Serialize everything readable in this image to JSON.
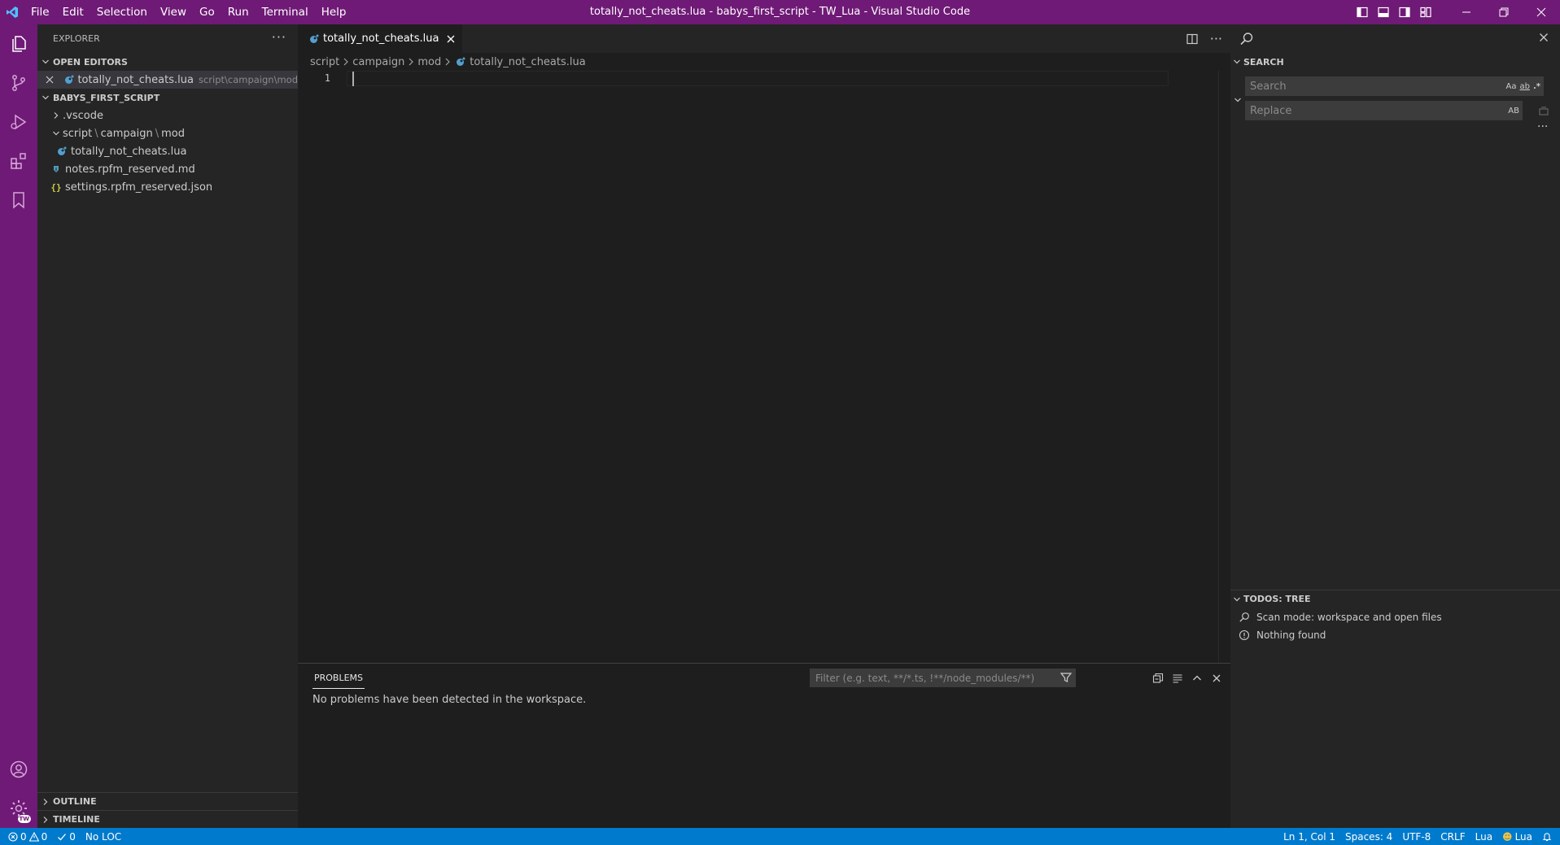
{
  "titlebar": {
    "menu": [
      "File",
      "Edit",
      "Selection",
      "View",
      "Go",
      "Run",
      "Terminal",
      "Help"
    ],
    "title": "totally_not_cheats.lua - babys_first_script - TW_Lua - Visual Studio Code"
  },
  "explorer": {
    "header": "EXPLORER",
    "open_editors_label": "OPEN EDITORS",
    "open_editor": {
      "name": "totally_not_cheats.lua",
      "path": "script\\campaign\\mod"
    },
    "workspace_label": "BABYS_FIRST_SCRIPT",
    "tree": {
      "vscode": ".vscode",
      "folder": {
        "seg1": "script",
        "seg2": "campaign",
        "seg3": "mod"
      },
      "file_lua": "totally_not_cheats.lua",
      "file_md": "notes.rpfm_reserved.md",
      "file_json": "settings.rpfm_reserved.json"
    },
    "outline_label": "OUTLINE",
    "timeline_label": "TIMELINE"
  },
  "editor": {
    "tab_label": "totally_not_cheats.lua",
    "breadcrumb": [
      "script",
      "campaign",
      "mod",
      "totally_not_cheats.lua"
    ],
    "line_number": "1"
  },
  "panel": {
    "tab": "PROBLEMS",
    "filter_placeholder": "Filter (e.g. text, **/*.ts, !**/node_modules/**)",
    "message": "No problems have been detected in the workspace."
  },
  "search": {
    "header": "SEARCH",
    "search_placeholder": "Search",
    "replace_placeholder": "Replace",
    "opt_case": "Aa",
    "opt_word": "ab",
    "opt_regex": ".*",
    "opt_preserve": "AB"
  },
  "todos": {
    "header": "TODOS: TREE",
    "scan_mode": "Scan mode: workspace and open files",
    "nothing": "Nothing found"
  },
  "statusbar": {
    "errors": "0",
    "warnings": "0",
    "checks": "0",
    "loc": "No LOC",
    "position": "Ln 1, Col 1",
    "spaces": "Spaces: 4",
    "encoding": "UTF-8",
    "eol": "CRLF",
    "language": "Lua",
    "lua_ext": "Lua"
  },
  "colors": {
    "titlebar": "#6f1a76",
    "activitybar": "#6f1a76",
    "statusbar": "#007acc",
    "editor_bg": "#1e1e1e",
    "sidebar_bg": "#252526"
  }
}
